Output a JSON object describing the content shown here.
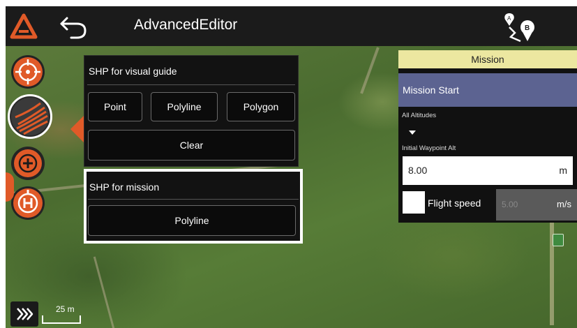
{
  "app": {
    "title": "AdvancedEditor",
    "logo_icon": "app-logo-icon",
    "back_icon": "back-arrow-icon",
    "route_icon": "route-a-to-b-icon"
  },
  "colors": {
    "accent": "#e05a28",
    "topbar": "#1b1b1b",
    "mission_header": "#ece7a0",
    "mission_start": "#5c6391"
  },
  "tools": [
    {
      "name": "target",
      "icon": "crosshair-icon"
    },
    {
      "name": "shp",
      "icon": "field-rows-icon",
      "selected": true
    },
    {
      "name": "add",
      "icon": "plus-circle-icon"
    },
    {
      "name": "home",
      "icon": "home-point-h-icon"
    }
  ],
  "shp_panel": {
    "visual_guide_title": "SHP for visual guide",
    "buttons": {
      "point": "Point",
      "polyline": "Polyline",
      "polygon": "Polygon",
      "clear": "Clear"
    },
    "mission_title": "SHP for mission",
    "mission_polyline": "Polyline"
  },
  "mission": {
    "header": "Mission",
    "start": "Mission Start",
    "altitude_label": "All Altitudes",
    "initial_waypoint_label": "Initial Waypoint Alt",
    "initial_waypoint_value": "8.00",
    "initial_waypoint_unit": "m",
    "flight_speed_label": "Flight speed",
    "flight_speed_value": "5.00",
    "flight_speed_unit": "m/s",
    "flight_speed_checked": false
  },
  "map": {
    "scale_label": "25 m",
    "expand_icon": "triple-chevron-right-icon"
  }
}
